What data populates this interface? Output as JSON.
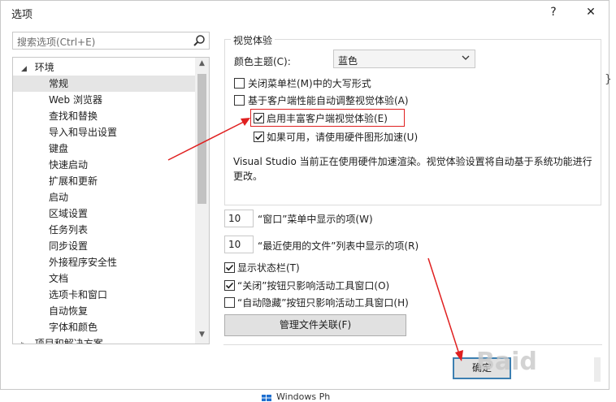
{
  "dialog": {
    "title": "选项",
    "help_glyph": "?",
    "close_glyph": "✕"
  },
  "search": {
    "placeholder": "搜索选项(Ctrl+E)"
  },
  "tree": {
    "root_label": "环境",
    "items": [
      "常规",
      "Web 浏览器",
      "查找和替换",
      "导入和导出设置",
      "键盘",
      "快速启动",
      "扩展和更新",
      "启动",
      "区域设置",
      "任务列表",
      "同步设置",
      "外接程序安全性",
      "文档",
      "选项卡和窗口",
      "自动恢复",
      "字体和颜色"
    ],
    "next_root_label": "项目和解决方案",
    "selected_item": "常规"
  },
  "visual": {
    "group_title": "视觉体验",
    "theme_label": "颜色主题(C):",
    "theme_value": "蓝色",
    "cb_uppercase": "关闭菜单栏(M)中的大写形式",
    "cb_auto_adjust": "基于客户端性能自动调整视觉体验(A)",
    "cb_rich": "启用丰富客户端视觉体验(E)",
    "cb_hw": "如果可用，请使用硬件图形加速(U)",
    "description": "Visual Studio 当前正在使用硬件加速渲染。视觉体验设置将自动基于系统功能进行更改。"
  },
  "window_menu": {
    "count": "10",
    "label": "“窗口”菜单中显示的项(W)"
  },
  "recent_files": {
    "count": "10",
    "label": "“最近使用的文件”列表中显示的项(R)"
  },
  "options": {
    "status_bar": "显示状态栏(T)",
    "close_affects": "“关闭”按钮只影响活动工具窗口(O)",
    "autohide_affects": "“自动隐藏”按钮只影响活动工具窗口(H)"
  },
  "buttons": {
    "manage_assoc": "管理文件关联(F)",
    "ok": "确定"
  },
  "watermark": "Baid",
  "taskbar": {
    "text": "Windows Ph"
  },
  "colors": {
    "accent": "#3c7fb1",
    "annotation_red": "#e02020",
    "selection_bg": "#e5e5e5"
  }
}
